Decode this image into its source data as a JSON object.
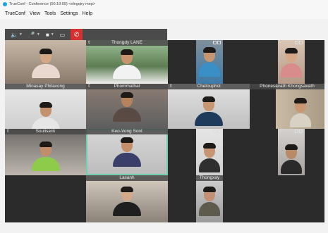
{
  "window": {
    "title": "TrueConf - Conference (00:19:09) <elegqiry mep>"
  },
  "menu": [
    "TrueConf",
    "View",
    "Tools",
    "Settings",
    "Help"
  ],
  "toolbar": {
    "speaker_icon": "speaker-icon",
    "mic_icon": "microphone-icon",
    "camera_icon": "camera-icon",
    "share_icon": "screen-share-icon",
    "hangup_icon": "phone-hangup-icon",
    "hangup_color": "#d63030"
  },
  "participants": [
    {
      "name": "",
      "pinned": false,
      "controls": false
    },
    {
      "name": "Thongdy LANE",
      "pinned": true,
      "controls": false
    },
    {
      "name": "",
      "pinned": false,
      "controls": true
    },
    {
      "name": "",
      "pinned": false,
      "controls": true
    },
    {
      "name": "Minasay Philavong",
      "pinned": false,
      "controls": false
    },
    {
      "name": "Phommathat",
      "pinned": true,
      "controls": false
    },
    {
      "name": "Chetouphol",
      "pinned": true,
      "controls": false
    },
    {
      "name": "Phonesavath Khongsavath",
      "pinned": false,
      "controls": false
    },
    {
      "name": "Soulisack",
      "pinned": true,
      "controls": false
    },
    {
      "name": "Keo-Vong Sont",
      "pinned": false,
      "controls": false
    },
    {
      "name": "",
      "pinned": false,
      "controls": true
    },
    {
      "name": "",
      "pinned": false,
      "controls": true
    },
    {
      "name": "Lasanh",
      "pinned": false,
      "controls": false
    },
    {
      "name": "Thongxay",
      "pinned": false,
      "controls": false
    }
  ],
  "colors": {
    "active_speaker_border": "#6fd0b0",
    "toolbar_bg": "#4b4b4b",
    "grid_bg": "#2b2b2b"
  }
}
